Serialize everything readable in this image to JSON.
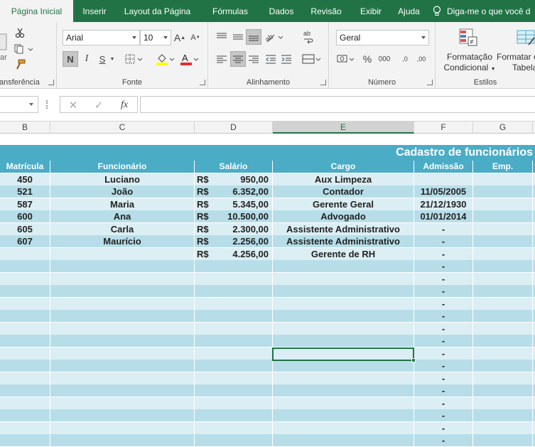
{
  "ribbon_tabs": [
    "Página Inicial",
    "Inserir",
    "Layout da Página",
    "Fórmulas",
    "Dados",
    "Revisão",
    "Exibir",
    "Ajuda"
  ],
  "tell_me": "Diga-me o que você d",
  "groups": {
    "clipboard": "ansferência",
    "font": "Fonte",
    "alignment": "Alinhamento",
    "number": "Número",
    "styles": "Estilos"
  },
  "font": {
    "name": "Arial",
    "size": "10",
    "grow": "A",
    "shrink": "A",
    "bold": "N",
    "italic": "I",
    "underline": "S"
  },
  "number": {
    "format": "Geral",
    "currency": "$",
    "percent": "%",
    "thousands": "000",
    "inc_dec": ",0",
    "dec_dec": ",00"
  },
  "styles": {
    "conditional_line1": "Formatação",
    "conditional_line2": "Condicional",
    "format_table_line1": "Formatar c",
    "format_table_line2": "Tabela"
  },
  "paste_partial": "ar",
  "formula_bar": {
    "fx": "fx"
  },
  "columns": [
    "B",
    "C",
    "D",
    "E",
    "F",
    "G"
  ],
  "sheet": {
    "title": "Cadastro de funcionários",
    "headers": [
      "Matrícula",
      "Funcionário",
      "Salário",
      "Cargo",
      "Admissão",
      "Emp."
    ],
    "currency_symbol": "R$",
    "rows": [
      {
        "mat": "450",
        "nome": "Luciano",
        "salario": "950,00",
        "cargo": "Aux Limpeza",
        "admissao": ""
      },
      {
        "mat": "521",
        "nome": "João",
        "salario": "6.352,00",
        "cargo": "Contador",
        "admissao": "11/05/2005"
      },
      {
        "mat": "587",
        "nome": "Maria",
        "salario": "5.345,00",
        "cargo": "Gerente Geral",
        "admissao": "21/12/1930"
      },
      {
        "mat": "600",
        "nome": "Ana",
        "salario": "10.500,00",
        "cargo": "Advogado",
        "admissao": "01/01/2014"
      },
      {
        "mat": "605",
        "nome": "Carla",
        "salario": "2.300,00",
        "cargo": "Assistente Administrativo",
        "admissao": "-"
      },
      {
        "mat": "607",
        "nome": "Maurício",
        "salario": "2.256,00",
        "cargo": "Assistente Administrativo",
        "admissao": "-"
      },
      {
        "mat": "",
        "nome": "",
        "salario": "4.256,00",
        "cargo": "Gerente de RH",
        "admissao": "-"
      }
    ],
    "empty_admissao": "-",
    "empty_row_count": 15
  },
  "colors": {
    "ribbon_green": "#217346",
    "header_teal": "#4bacc6",
    "band_light": "#dbeef4",
    "band_dark": "#b7dee8"
  }
}
